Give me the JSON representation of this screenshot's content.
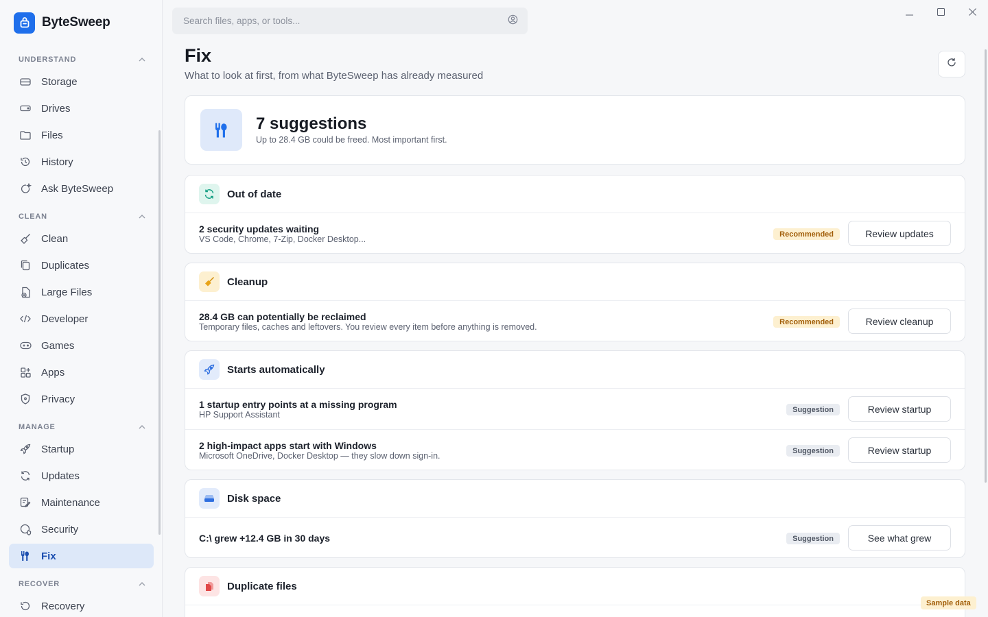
{
  "app": {
    "name": "ByteSweep"
  },
  "search": {
    "placeholder": "Search files, apps, or tools..."
  },
  "sidebar": {
    "sections": [
      {
        "label": "UNDERSTAND",
        "items": [
          {
            "label": "Storage",
            "icon": "storage-icon"
          },
          {
            "label": "Drives",
            "icon": "drive-icon"
          },
          {
            "label": "Files",
            "icon": "folder-icon"
          },
          {
            "label": "History",
            "icon": "history-icon"
          },
          {
            "label": "Ask ByteSweep",
            "icon": "assistant-icon"
          }
        ]
      },
      {
        "label": "CLEAN",
        "items": [
          {
            "label": "Clean",
            "icon": "broom-icon"
          },
          {
            "label": "Duplicates",
            "icon": "duplicate-icon"
          },
          {
            "label": "Large Files",
            "icon": "large-file-icon"
          },
          {
            "label": "Developer",
            "icon": "code-icon"
          },
          {
            "label": "Games",
            "icon": "gamepad-icon"
          },
          {
            "label": "Apps",
            "icon": "apps-icon"
          },
          {
            "label": "Privacy",
            "icon": "shield-icon"
          }
        ]
      },
      {
        "label": "MANAGE",
        "items": [
          {
            "label": "Startup",
            "icon": "rocket-icon"
          },
          {
            "label": "Updates",
            "icon": "refresh-icon"
          },
          {
            "label": "Maintenance",
            "icon": "maintenance-icon"
          },
          {
            "label": "Security",
            "icon": "security-icon"
          },
          {
            "label": "Fix",
            "icon": "tools-icon",
            "active": true
          }
        ]
      },
      {
        "label": "RECOVER",
        "items": [
          {
            "label": "Recovery",
            "icon": "recovery-icon"
          }
        ]
      }
    ]
  },
  "page": {
    "title": "Fix",
    "subtitle": "What to look at first, from what ByteSweep has already measured"
  },
  "summary": {
    "title": "7 suggestions",
    "subtitle": "Up to 28.4 GB could be freed. Most important first."
  },
  "groups": [
    {
      "title": "Out of date",
      "icon": "refresh-icon",
      "icon_bg": "#dff5ee",
      "icon_color": "#17a085",
      "rows": [
        {
          "title": "2 security updates waiting",
          "subtitle": "VS Code, Chrome, 7-Zip, Docker Desktop...",
          "badge": "Recommended",
          "badge_kind": "rec",
          "action": "Review updates"
        }
      ]
    },
    {
      "title": "Cleanup",
      "icon": "broom-icon",
      "icon_bg": "#fdf0d0",
      "icon_color": "#d4900f",
      "rows": [
        {
          "title": "28.4 GB can potentially be reclaimed",
          "subtitle": "Temporary files, caches and leftovers. You review every item before anything is removed.",
          "badge": "Recommended",
          "badge_kind": "rec",
          "action": "Review cleanup"
        }
      ]
    },
    {
      "title": "Starts automatically",
      "icon": "rocket-icon",
      "icon_bg": "#e2ebfb",
      "icon_color": "#2f6fe0",
      "rows": [
        {
          "title": "1 startup entry points at a missing program",
          "subtitle": "HP Support Assistant",
          "badge": "Suggestion",
          "badge_kind": "sug",
          "action": "Review startup"
        },
        {
          "title": "2 high-impact apps start with Windows",
          "subtitle": "Microsoft OneDrive, Docker Desktop — they slow down sign-in.",
          "badge": "Suggestion",
          "badge_kind": "sug",
          "action": "Review startup"
        }
      ]
    },
    {
      "title": "Disk space",
      "icon": "disk-icon",
      "icon_bg": "#e2ebfb",
      "icon_color": "#2f6fe0",
      "rows": [
        {
          "title": "C:\\ grew +12.4 GB in 30 days",
          "subtitle": "",
          "badge": "Suggestion",
          "badge_kind": "sug",
          "action": "See what grew"
        }
      ]
    },
    {
      "title": "Duplicate files",
      "icon": "duplicate-file-icon",
      "icon_bg": "#fde4e4",
      "icon_color": "#e04848",
      "rows": []
    }
  ],
  "footer": {
    "sample_badge": "Sample data"
  },
  "colors": {
    "accent": "#1f6feb",
    "active_bg": "#dde8f9",
    "recommended_bg": "#fdf0d0",
    "recommended_fg": "#a05c06"
  }
}
